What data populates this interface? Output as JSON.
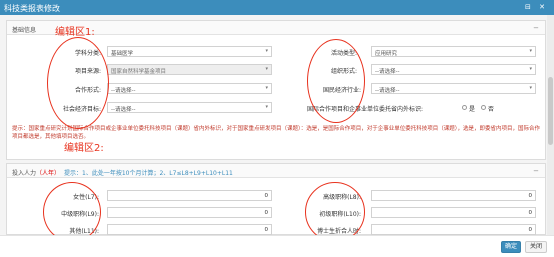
{
  "window": {
    "title": "科技类报表修改",
    "icons": "⊟ ✕"
  },
  "section1": {
    "title": "基础信息",
    "annotation": "编辑区1:",
    "fields": {
      "subject_label": "学科分类:",
      "subject_value": "基础医学",
      "activity_label": "活动类型:",
      "activity_value": "应用研究",
      "source_label": "项目来源:",
      "source_value": "国家自然科学基金项目",
      "org_label": "组织形式:",
      "org_value": "--请选择--",
      "coop_label": "合作形式:",
      "coop_value": "--请选择--",
      "economy_label": "国民经济行业:",
      "economy_value": "--请选择--",
      "social_label": "社会经济目标:",
      "social_value": "--请选择--",
      "intl_label": "国际合作项目和企事业单位委托省内外标识:",
      "radio_yes": "是",
      "radio_no": "否"
    },
    "hint": "提示：国家重点研究计划国际合作项目或企事业单位委托科技项目（课题）省内外标识，对于国家重点研发项目（课题）：选是，是国际合作项目，对于企事业单位委托科技项目（课题），选是，即委省内项目，国际合作项目都选是，其他填项目选否。"
  },
  "section2": {
    "title": "投入人力",
    "unit": "（人年）",
    "hint": "提示：1、此处一年按10个月计算；2、L7≤L8+L9+L10+L11",
    "annotation": "编辑区2:",
    "fields": {
      "female_label": "女性(L7):",
      "female_value": "0",
      "senior_label": "高级职称(L8):",
      "senior_value": "0",
      "middle_label": "中级职称(L9):",
      "middle_value": "0",
      "junior_label": "初级职称(L10):",
      "junior_value": "0",
      "other_label": "其他(L11):",
      "other_value": "0",
      "grad_label": "博士生折合人时:",
      "grad_value": "0"
    }
  },
  "footer": {
    "ok_label": "确定",
    "close_label": "关闭"
  }
}
